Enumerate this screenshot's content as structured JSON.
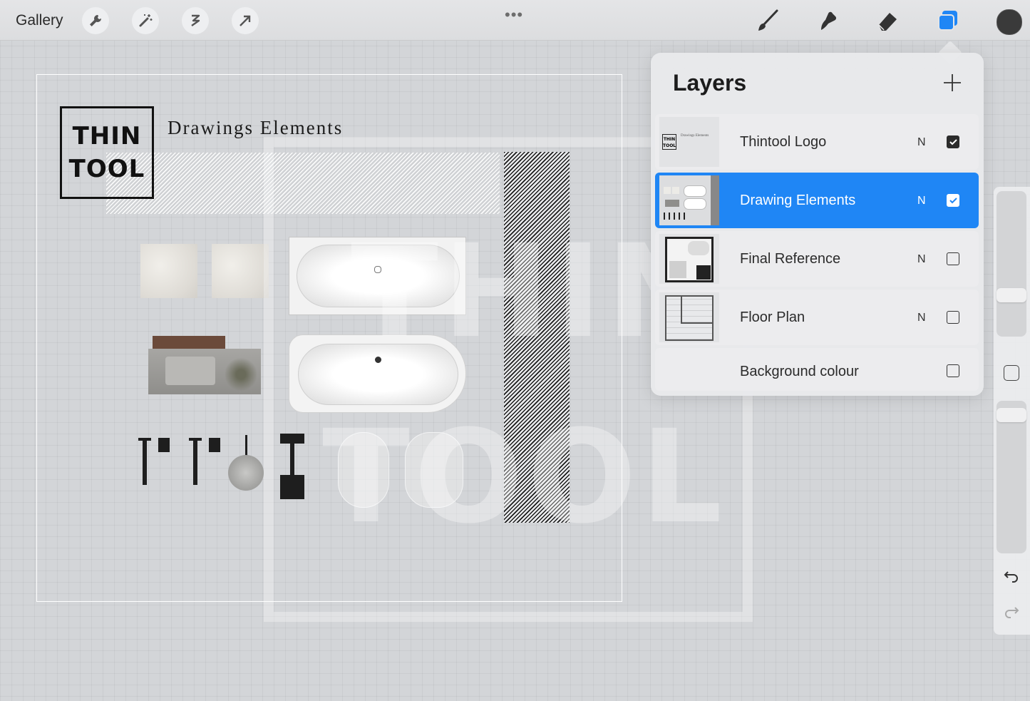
{
  "toolbar": {
    "gallery_label": "Gallery",
    "left_tools": [
      "wrench-icon",
      "magic-wand-icon",
      "selection-icon",
      "transform-arrow-icon"
    ],
    "more_label": "•••",
    "right_tools": [
      "brush-icon",
      "smudge-icon",
      "eraser-icon",
      "layers-icon"
    ],
    "active_color": "#3a3a3a",
    "accent_color": "#1f86f5"
  },
  "canvas": {
    "logo_line1": "THIN",
    "logo_line2": "TOOL",
    "title": "Drawings Elements",
    "watermark_line1": "THIN",
    "watermark_line2": "TOOL"
  },
  "layers_panel": {
    "title": "Layers",
    "layers": [
      {
        "name": "Thintool Logo",
        "mode": "N",
        "visible": true,
        "active": false
      },
      {
        "name": "Drawing Elements",
        "mode": "N",
        "visible": true,
        "active": true
      },
      {
        "name": "Final Reference",
        "mode": "N",
        "visible": false,
        "active": false
      },
      {
        "name": "Floor Plan",
        "mode": "N",
        "visible": false,
        "active": false
      },
      {
        "name": "Background colour",
        "mode": "",
        "visible": false,
        "active": false
      }
    ]
  },
  "thumbnails": {
    "logo_line1": "THIN",
    "logo_line2": "TOOL",
    "caption": "Drawings Elements"
  }
}
